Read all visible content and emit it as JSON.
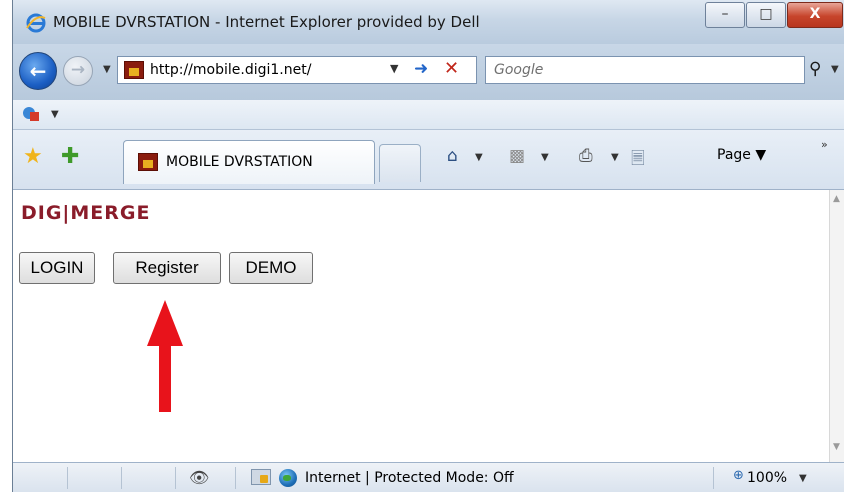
{
  "window": {
    "title": "MOBILE DVRSTATION - Internet Explorer provided by Dell",
    "minimize_glyph": "–",
    "maximize_glyph": "□",
    "close_glyph": "X"
  },
  "navigation": {
    "address": "http://mobile.digi1.net/",
    "search_placeholder": "Google"
  },
  "tab": {
    "label": "MOBILE DVRSTATION"
  },
  "commandbar": {
    "page_label": "Page",
    "overflow": "»"
  },
  "content": {
    "logo_text": "DIG|MERGE",
    "buttons": [
      {
        "label": "LOGIN"
      },
      {
        "label": "Register"
      },
      {
        "label": "DEMO"
      }
    ],
    "annotation_arrow_color": "#e8131b"
  },
  "statusbar": {
    "zone_text": "Internet | Protected Mode: Off",
    "zoom": "100%"
  },
  "icons": [
    "ie-logo-icon",
    "back-arrow-icon",
    "forward-arrow-icon",
    "favicon-dvr-icon",
    "go-arrow-icon",
    "stop-icon",
    "search-icon",
    "favorites-star-icon",
    "add-favorite-icon",
    "home-icon",
    "feeds-icon",
    "print-icon",
    "page-icon",
    "privacy-icon",
    "globe-icon",
    "zoom-icon"
  ]
}
